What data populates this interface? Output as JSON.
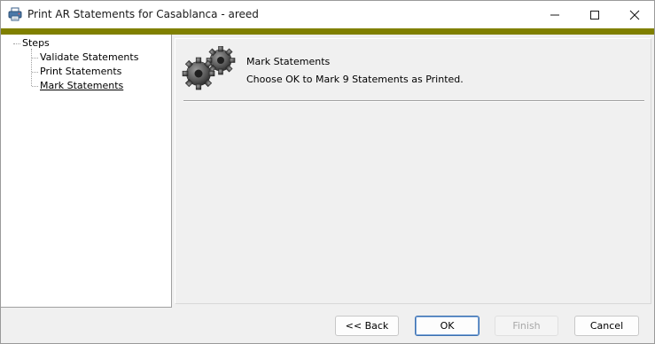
{
  "window": {
    "title": "Print AR Statements for Casablanca - areed",
    "icon": "printer-icon",
    "controls": [
      "minimize-icon",
      "maximize-icon",
      "close-icon"
    ],
    "accent_color": "#808000"
  },
  "tree": {
    "root_label": "Steps",
    "items": [
      {
        "label": "Validate Statements",
        "selected": false
      },
      {
        "label": "Print Statements",
        "selected": false
      },
      {
        "label": "Mark Statements",
        "selected": true
      }
    ]
  },
  "main": {
    "icon": "gears-icon",
    "heading": "Mark Statements",
    "message": "Choose OK to Mark 9 Statements as Printed."
  },
  "buttons": {
    "back": {
      "label": "<< Back",
      "enabled": true
    },
    "ok": {
      "label": "OK",
      "enabled": true,
      "default": true
    },
    "finish": {
      "label": "Finish",
      "enabled": false
    },
    "cancel": {
      "label": "Cancel",
      "enabled": true
    }
  }
}
